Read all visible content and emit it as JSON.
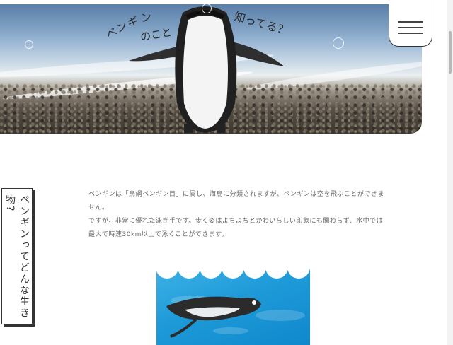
{
  "hero": {
    "title_line1": [
      "ペ",
      "ン",
      "ギ",
      "ン"
    ],
    "title_line2": "のこと",
    "title_line3": "知ってる？"
  },
  "menu": {
    "icon": "hamburger-icon"
  },
  "section": {
    "vertical_title": "ペンギンってどんな生き物?",
    "paragraphs": [
      "ペンギンは「鳥綱ペンギン目」に属し、海鳥に分類されますが、ペンギンは空を飛ぶことができま",
      "せん。",
      "ですが、非常に優れた泳ぎ手です。歩く姿はよちよちとかわいらしい印象にも関わらず、水中では",
      "最大で時速30km以上で泳ぐことができます。"
    ]
  },
  "colors": {
    "water": "#1e9ad8",
    "text": "#666666",
    "border": "#333333"
  }
}
